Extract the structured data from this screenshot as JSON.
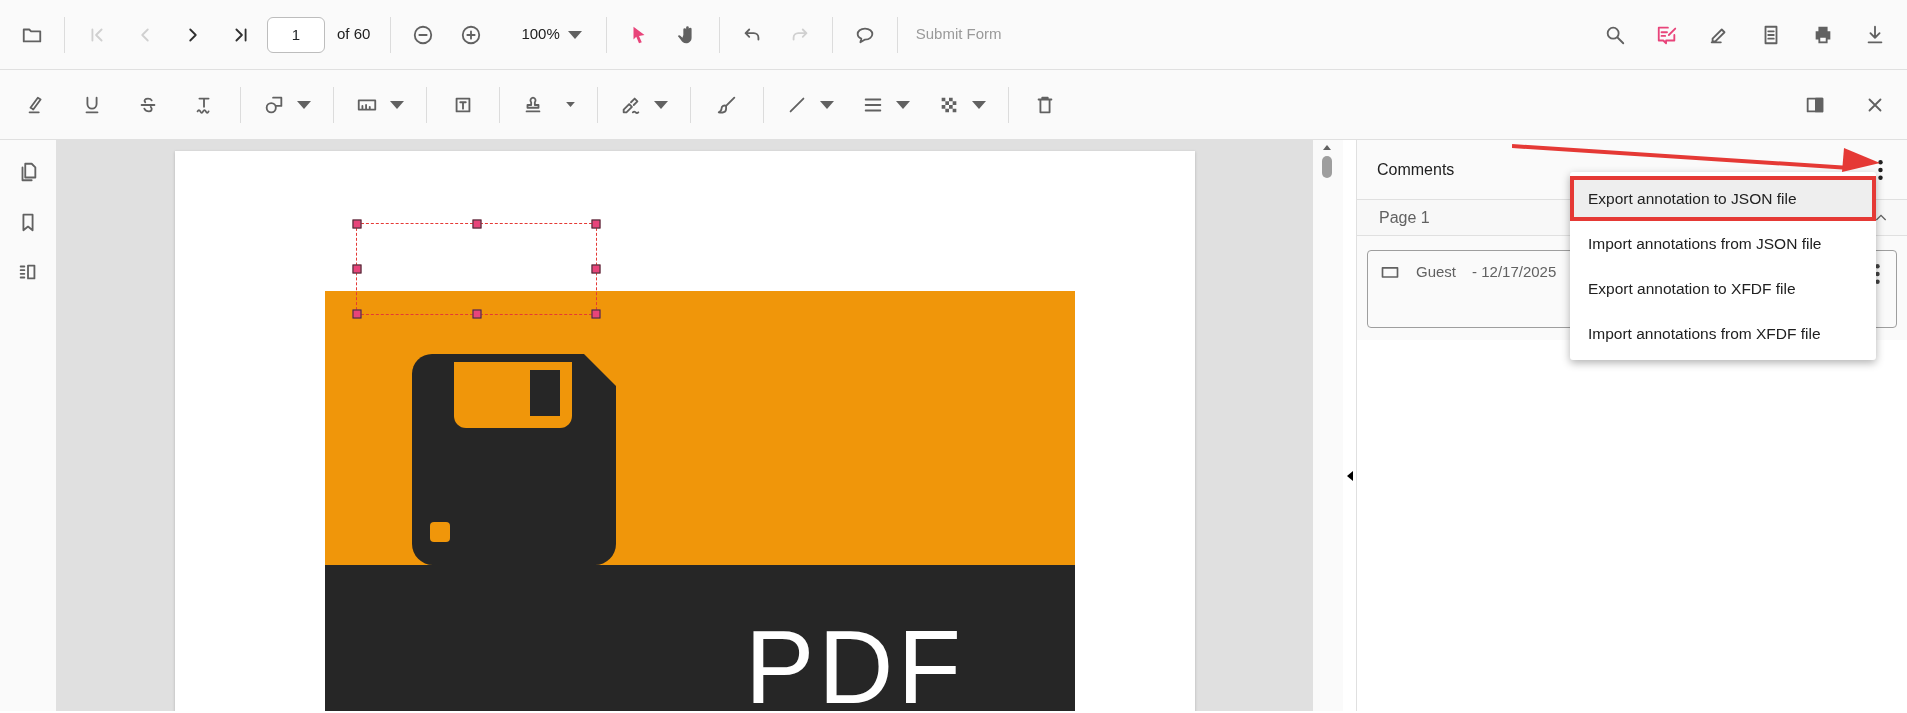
{
  "main_toolbar": {
    "open": {
      "disabled": false
    },
    "navigation": [
      {
        "disabled": true
      },
      {
        "disabled": true
      },
      {
        "disabled": false
      },
      {
        "disabled": false
      }
    ],
    "page_number": "1",
    "page_count": "of 60",
    "zoom_value": "100%",
    "interaction": [
      {
        "selected": true
      },
      {
        "selected": false
      }
    ],
    "history": [
      {
        "disabled": false
      },
      {
        "disabled": true
      }
    ],
    "submit_form": {
      "label": "Submit Form",
      "disabled": true
    },
    "right_tools": [
      {
        "selected": false
      },
      {
        "selected": true
      },
      {
        "selected": false
      },
      {
        "selected": false
      },
      {
        "selected": false
      },
      {
        "selected": false
      }
    ]
  },
  "annotation_toolbar": {
    "groups": [
      [
        {
          "kind": "button"
        },
        {
          "kind": "button"
        },
        {
          "kind": "button"
        },
        {
          "kind": "button"
        }
      ],
      [
        {
          "kind": "dropdown"
        }
      ],
      [
        {
          "kind": "dropdown"
        }
      ],
      [
        {
          "kind": "button"
        }
      ],
      [
        {
          "kind": "dropdown"
        }
      ],
      [
        {
          "kind": "dropdown"
        }
      ],
      [
        {
          "kind": "button"
        }
      ],
      [
        {
          "kind": "dropdown"
        },
        {
          "kind": "dropdown"
        },
        {
          "kind": "dropdown"
        }
      ],
      [
        {
          "kind": "button"
        }
      ]
    ]
  },
  "document": {
    "annotation": {
      "selected": true
    },
    "banner_text": "PDF"
  },
  "comments": {
    "title": "Comments",
    "pages": [
      {
        "label": "Page 1",
        "expanded": true,
        "comments": [
          {
            "author": "Guest",
            "date": "- 12/17/2025"
          }
        ]
      }
    ]
  },
  "comment_menu": {
    "items": [
      {
        "label": "Export annotation to JSON file",
        "selected": true
      },
      {
        "label": "Import annotations from JSON file",
        "selected": false
      },
      {
        "label": "Export annotation to XFDF file",
        "selected": false
      },
      {
        "label": "Import annotations from XFDF file",
        "selected": false
      }
    ]
  }
}
